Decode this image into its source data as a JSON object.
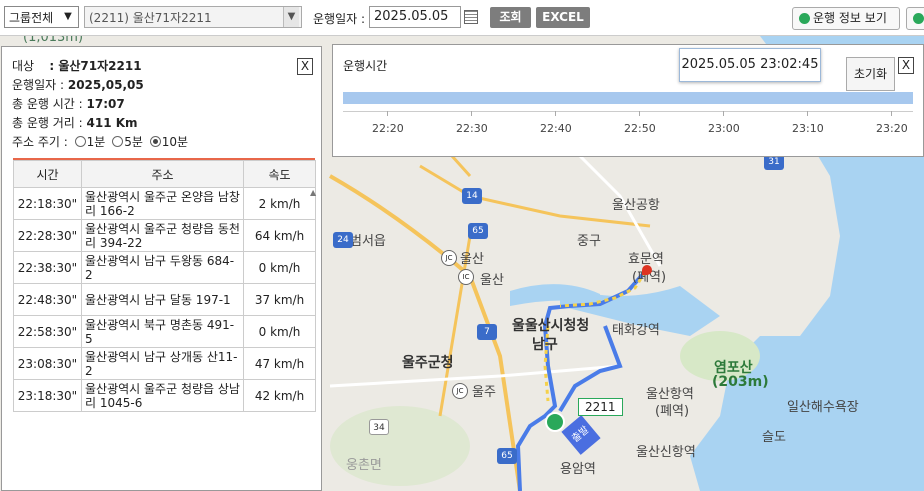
{
  "toolbar": {
    "group_select": "그룹전체",
    "vehicle_select": "(2211) 울산71자2211",
    "date_label": "운행일자 :",
    "date_value": "2025.05.05",
    "search_button": "조회",
    "excel_button": "EXCEL",
    "info_button": "운행 정보 보기"
  },
  "panel": {
    "close": "X",
    "target_label": "대상",
    "target_value": ": 울산71자2211",
    "date_label": "운행일자 : ",
    "date_value": "2025,05,05",
    "time_label": "총 운행 시간 : ",
    "time_value": "17:07",
    "distance_label": "총 운행 거리 : ",
    "distance_value": "411 Km",
    "interval_label": "주소 주기 :",
    "interval_options": [
      "1분",
      "5분",
      "10분"
    ],
    "interval_selected": "10분",
    "columns": [
      "시간",
      "주소",
      "속도"
    ],
    "rows": [
      {
        "time": "22:18:30\"",
        "addr": "울산광역시 울주군 온양읍 남창리 166-2",
        "speed": "2 km/h"
      },
      {
        "time": "22:28:30\"",
        "addr": "울산광역시 울주군 청량읍 동천리 394-22",
        "speed": "64 km/h"
      },
      {
        "time": "22:38:30\"",
        "addr": "울산광역시 남구 두왕동 684-2",
        "speed": "0 km/h"
      },
      {
        "time": "22:48:30\"",
        "addr": "울산광역시 남구 달동 197-1",
        "speed": "37 km/h"
      },
      {
        "time": "22:58:30\"",
        "addr": "울산광역시 북구 명촌동 491-5",
        "speed": "0 km/h"
      },
      {
        "time": "23:08:30\"",
        "addr": "울산광역시 남구 상개동 산11-2",
        "speed": "47 km/h"
      },
      {
        "time": "23:18:30\"",
        "addr": "울산광역시 울주군 청량읍 상남리 1045-6",
        "speed": "42 km/h"
      }
    ]
  },
  "timeline": {
    "title": "운행시간",
    "tooltip": "2025.05.05 23:02:45",
    "reset_button": "초기화",
    "close": "X",
    "ticks": [
      "22:20",
      "22:30",
      "22:40",
      "22:50",
      "23:00",
      "23:10",
      "23:20"
    ]
  },
  "map": {
    "labels": {
      "beomseo": "범서읍",
      "ulsan_jc": "울산",
      "ulsan_ic": "울산",
      "jung_gu": "중구",
      "ulsan_city": "울울산시청청",
      "namgu": "남구",
      "ulju_office": "울주군청",
      "ulju_ic": "울주",
      "airport": "울산공항",
      "hyomun": "효문역",
      "hyomun_sub": "(폐역)",
      "taehwa": "태화강역",
      "yeompo": "염포산",
      "yeompo_h": "(203m)",
      "ulsan_port": "울산항역",
      "ulsan_port_sub": "(폐역)",
      "ilsan": "일산해수욕장",
      "seuldo": "슬도",
      "ulsan_newport": "울산신항역",
      "yongam": "용암역",
      "ungchon": "웅촌면",
      "elev": "(1,013m)",
      "start": "출발",
      "marker_id": "2211",
      "road_14": "14",
      "road_65": "65",
      "road_24": "24",
      "road_7": "7",
      "road_34": "34",
      "road_31": "31"
    }
  }
}
